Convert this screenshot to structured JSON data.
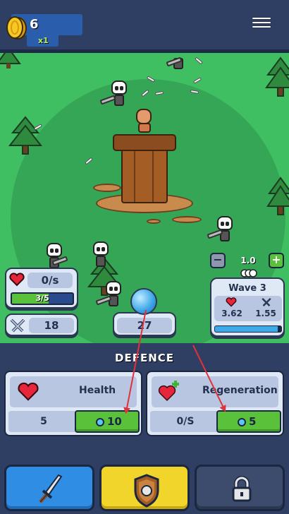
{
  "hud": {
    "coins": "6",
    "multiplier": "x1"
  },
  "player": {
    "hp_rate": "0/s",
    "hp_bar_text": "3/5",
    "hp_fraction": 0.6,
    "attack": "18",
    "orb_value": "27"
  },
  "speed": {
    "value": "1.0",
    "minus_icon": "minus-icon",
    "plus_icon": "plus-icon"
  },
  "wave": {
    "title": "Wave 3",
    "health": "3.62",
    "damage": "1.55",
    "progress_fraction": 0.95
  },
  "defence": {
    "title": "DEFENCE",
    "cards": [
      {
        "name": "Health",
        "value": "5",
        "cost": "10"
      },
      {
        "name": "Regeneration",
        "value": "0/S",
        "cost": "5"
      }
    ]
  },
  "tabs": [
    {
      "icon": "sword-icon"
    },
    {
      "icon": "shield-icon"
    },
    {
      "icon": "lock-icon"
    }
  ],
  "colors": {
    "field": "#3fbf62",
    "range": "#35a656",
    "panel": "#dfe8f5",
    "buy_button": "#5ac23a",
    "tab_attack": "#2f8ee3",
    "tab_defence": "#f2d52a",
    "tab_locked": "#3d4c6d",
    "annotation_arrow": "#e0323a"
  }
}
